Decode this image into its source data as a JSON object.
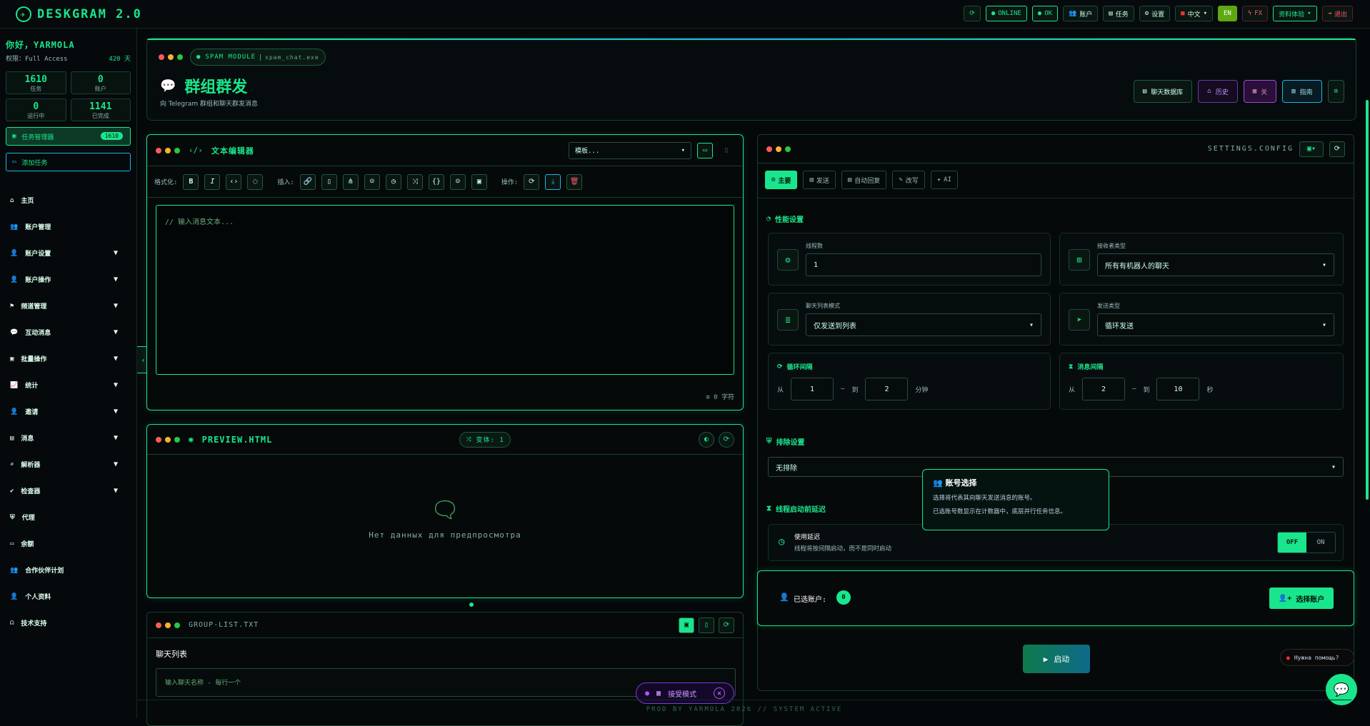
{
  "app": {
    "title": "DESKGRAM 2.0"
  },
  "topbar": {
    "online": "ONLINE",
    "ok": "OK",
    "accounts": "账户",
    "tasks": "任务",
    "settings": "设置",
    "language": "中文",
    "lang_badge": "EN",
    "fx": "FX",
    "resources": "资料体验",
    "logout": "退出"
  },
  "sidebar": {
    "greeting": "你好，YARMOLA",
    "access": "权限：Full Access",
    "days": "420 天",
    "stats": [
      {
        "value": "1610",
        "label": "任务"
      },
      {
        "value": "0",
        "label": "账户"
      },
      {
        "value": "0",
        "label": "运行中"
      },
      {
        "value": "1141",
        "label": "已完成"
      }
    ],
    "task_manager": "任务管理器",
    "task_count": "1610",
    "second_item": "添加任务",
    "nav": [
      {
        "label": "主页",
        "icon": "home-icon",
        "chevron": false
      },
      {
        "label": "账户管理",
        "icon": "users-icon",
        "chevron": false
      },
      {
        "label": "账户设置",
        "icon": "user-cog-icon",
        "chevron": true
      },
      {
        "label": "账户操作",
        "icon": "user-action-icon",
        "chevron": true
      },
      {
        "label": "频道管理",
        "icon": "flag-icon",
        "chevron": true
      },
      {
        "label": "互动消息",
        "icon": "chat-icon",
        "chevron": true
      },
      {
        "label": "批量操作",
        "icon": "briefcase-icon",
        "chevron": true
      },
      {
        "label": "统计",
        "icon": "chart-icon",
        "chevron": true
      },
      {
        "label": "邀请",
        "icon": "invite-icon",
        "chevron": true
      },
      {
        "label": "消息",
        "icon": "inbox-icon",
        "chevron": true
      },
      {
        "label": "解析器",
        "icon": "search-icon",
        "chevron": true
      },
      {
        "label": "检查器",
        "icon": "check-icon",
        "chevron": true
      },
      {
        "label": "代理",
        "icon": "shield-icon",
        "chevron": false
      },
      {
        "label": "余额",
        "icon": "card-icon",
        "chevron": false
      },
      {
        "label": "合作伙伴计划",
        "icon": "partners-icon",
        "chevron": false
      },
      {
        "label": "个人资料",
        "icon": "profile-icon",
        "chevron": false
      },
      {
        "label": "技术支持",
        "icon": "support-icon",
        "chevron": false
      }
    ]
  },
  "header": {
    "module": "SPAM MODULE",
    "module_file": "spam_chat.exe",
    "title": "群组群发",
    "subtitle": "向 Telegram 群组和聊天群发消息",
    "btn_chat_db": "聊天数据库",
    "btn_history": "历史",
    "btn_off": "关",
    "btn_guide": "指南"
  },
  "editor": {
    "title": "文本编辑器",
    "template_placeholder": "模板...",
    "format_label": "格式化:",
    "insert_label": "插入:",
    "action_label": "操作:",
    "placeholder": "// 输入消息文本...",
    "char_count": "0 字符"
  },
  "preview": {
    "title": "PREVIEW.HTML",
    "variants": "变体: 1",
    "empty": "Нет данных для предпросмотра"
  },
  "group_list": {
    "title": "GROUP-LIST.TXT",
    "subtitle": "聊天列表",
    "placeholder": "输入聊天名称 - 每行一个"
  },
  "settings": {
    "header": "SETTINGS.CONFIG",
    "tabs": [
      "主要",
      "发送",
      "自动回复",
      "改写",
      "AI"
    ],
    "perf_section": "性能设置",
    "threads_label": "线程数",
    "threads_value": "1",
    "recipient_label": "接收者类型",
    "recipient_value": "所有有机器人的聊天",
    "chatlist_label": "聊天列表模式",
    "chatlist_value": "仅发送到列表",
    "sendtype_label": "发送类型",
    "sendtype_value": "循环发送",
    "cycle_label": "循环间隔",
    "cycle_from": "1",
    "cycle_to": "2",
    "cycle_unit": "分钟",
    "msg_label": "消息间隔",
    "msg_from": "2",
    "msg_to": "10",
    "msg_unit": "秒",
    "from": "从",
    "to": "到",
    "exclude_section": "排除设置",
    "exclude_value": "无排除",
    "delay_section": "线程启动前延迟",
    "delay_title": "使用延迟",
    "delay_desc": "线程将按间隔启动，而不是同时启动",
    "off": "OFF",
    "on": "ON",
    "selected_accounts": "已选账户:",
    "selected_count": "0",
    "select_btn": "选择账户",
    "start_btn": "启动"
  },
  "tooltip": {
    "title": "账号选择",
    "line1": "选择将代表其向聊天发送消息的账号。",
    "line2": "已选账号数显示在计数器中，底层并行任务信息。"
  },
  "float": {
    "demo_mode": "接受模式",
    "help": "Нужна помощь?",
    "footer": "PROD BY YARMOLA 2026 // SYSTEM ACTIVE"
  }
}
